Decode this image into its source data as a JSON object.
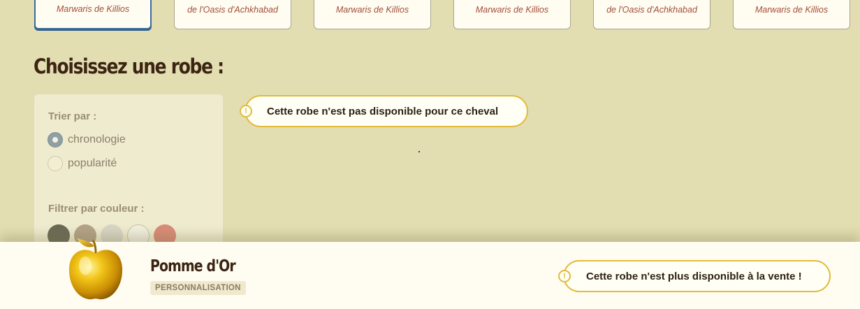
{
  "breed_cards": [
    {
      "name": "Marwaris de Killios",
      "selected": true
    },
    {
      "name": "de l'Oasis d'Achkhabad",
      "selected": false
    },
    {
      "name": "Marwaris de Killios",
      "selected": false
    },
    {
      "name": "Marwaris de Killios",
      "selected": false
    },
    {
      "name": "de l'Oasis d'Achkhabad",
      "selected": false
    },
    {
      "name": "Marwaris de Killios",
      "selected": false
    }
  ],
  "page_title": "Choisissez une robe :",
  "sort": {
    "label": "Trier par :",
    "options": [
      {
        "label": "chronologie",
        "checked": true
      },
      {
        "label": "popularité",
        "checked": false
      }
    ]
  },
  "filter": {
    "label": "Filtrer par couleur :",
    "colors": [
      "#6b6a55",
      "#b3a287",
      "#d8d5c4",
      "#f1efdf",
      "#d98b78"
    ]
  },
  "unavailable_notice": "Cette robe n'est pas disponible pour ce cheval",
  "product": {
    "name": "Pomme d'Or",
    "category": "PERSONNALISATION",
    "sale_notice": "Cette robe n'est plus disponible à la vente !"
  },
  "colors": {
    "accent_warning": "#e2bb3c",
    "selected_border": "#3a6b9c",
    "title_text": "#3b2413"
  }
}
